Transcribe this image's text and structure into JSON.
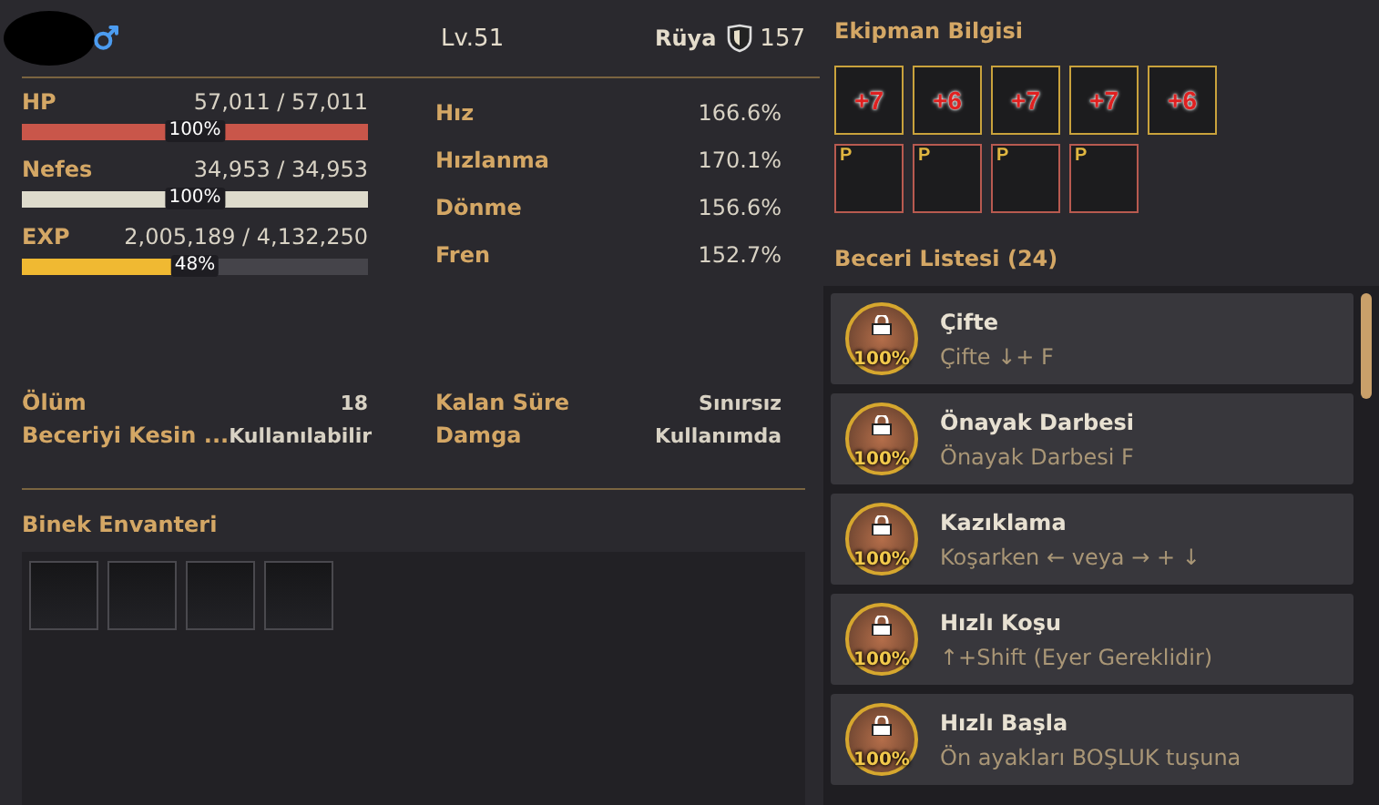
{
  "character": {
    "level": "Lv.51",
    "rank": "Rüya",
    "rank_value": "157"
  },
  "vitals": [
    {
      "label": "HP",
      "value": "57,011 / 57,011",
      "level": 1,
      "reading": "100%",
      "color": "#c9564a"
    },
    {
      "label": "Nefes",
      "value": "34,953 / 34,953",
      "level": 1,
      "reading": "100%",
      "color": "#dedbcc"
    },
    {
      "label": "EXP",
      "value": "2,005,189 / 4,132,250",
      "level": 0.485,
      "reading": "48%",
      "color": "#f0b932"
    }
  ],
  "speed_stats": [
    {
      "label": "Hız",
      "value": "166.6%"
    },
    {
      "label": "Hızlanma",
      "value": "170.1%"
    },
    {
      "label": "Dönme",
      "value": "156.6%"
    },
    {
      "label": "Fren",
      "value": "152.7%"
    }
  ],
  "info": [
    {
      "label": "Ölüm",
      "value": "18"
    },
    {
      "label": "Kalan Süre",
      "value": "Sınırsız"
    },
    {
      "label": "Beceriyi Kesin ...",
      "value": "Kullanılabilir"
    },
    {
      "label": "Damga",
      "value": "Kullanımda"
    }
  ],
  "mount_inventory": {
    "title": "Binek Envanteri",
    "slots": [
      {
        "kind": "empty"
      },
      {
        "kind": "empty"
      },
      {
        "kind": "empty"
      },
      {
        "kind": "empty"
      }
    ]
  },
  "equipment": {
    "title": "Ekipman Bilgisi",
    "items": [
      {
        "kind": "enhanced",
        "badge": "+7"
      },
      {
        "kind": "enhanced",
        "badge": "+6"
      },
      {
        "kind": "enhanced",
        "badge": "+7"
      },
      {
        "kind": "enhanced",
        "badge": "+7"
      },
      {
        "kind": "enhanced",
        "badge": "+6"
      },
      {
        "kind": "premium",
        "badge": "P"
      },
      {
        "kind": "premium",
        "badge": "P"
      },
      {
        "kind": "premium",
        "badge": "P"
      },
      {
        "kind": "premium",
        "badge": "P"
      }
    ]
  },
  "skills": {
    "title": "Beceri Listesi (24)",
    "items": [
      {
        "name": "Çifte",
        "key": "Çifte ↓+ F",
        "mastery": "100%"
      },
      {
        "name": "Önayak Darbesi",
        "key": "Önayak Darbesi F",
        "mastery": "100%"
      },
      {
        "name": "Kazıklama",
        "key": "Koşarken ← veya → + ↓",
        "mastery": "100%"
      },
      {
        "name": "Hızlı Koşu",
        "key": "↑+Shift (Eyer Gereklidir)",
        "mastery": "100%"
      },
      {
        "name": "Hızlı Başla",
        "key": "Ön ayakları BOŞLUK tuşuna",
        "mastery": "100%"
      }
    ]
  }
}
